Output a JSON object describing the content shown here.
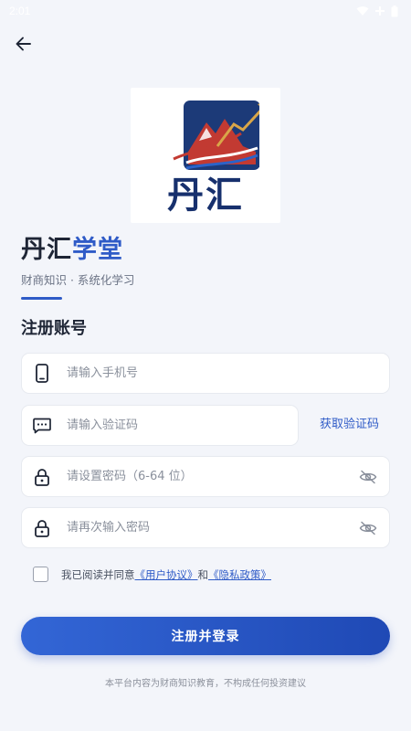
{
  "status_bar": {
    "time": "2:01",
    "icons": [
      "wifi-icon",
      "signal-icon",
      "battery-icon"
    ]
  },
  "header": {
    "back_icon": "arrow-left-icon"
  },
  "logo": {
    "text": "丹汇"
  },
  "brand": {
    "title_part1": "丹汇",
    "title_part2": "学堂",
    "subtitle": "财商知识 · 系统化学习"
  },
  "form": {
    "title": "注册账号",
    "phone": {
      "placeholder": "请输入手机号",
      "value": "",
      "icon": "phone-icon"
    },
    "code": {
      "placeholder": "请输入验证码",
      "value": "",
      "icon": "message-icon",
      "get_code_label": "获取验证码"
    },
    "password": {
      "placeholder": "请设置密码（6-64 位）",
      "value": "",
      "icon": "lock-icon",
      "toggle_icon": "eye-off-icon"
    },
    "confirm_password": {
      "placeholder": "请再次输入密码",
      "value": "",
      "icon": "lock-icon",
      "toggle_icon": "eye-off-icon"
    },
    "agreement": {
      "checked": false,
      "prefix": "我已阅读并同意",
      "user_agreement": "《用户协议》",
      "conjunction": "和",
      "privacy_policy": "《隐私政策》"
    },
    "submit_label": "注册并登录"
  },
  "disclaimer": "本平台内容为财商知识教育，不构成任何投资建议",
  "colors": {
    "accent": "#2f5bc7",
    "background": "#f3f5fa",
    "logo_navy": "#17306d",
    "logo_red": "#c23a32",
    "logo_gold": "#d9a648"
  }
}
